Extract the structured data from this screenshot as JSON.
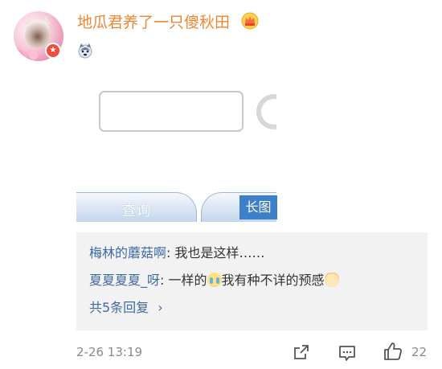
{
  "post": {
    "username": "地瓜君养了一只傻秋田",
    "timestamp": "2-26 13:19",
    "like_count": "22",
    "avatar_badge_icon": "red-star-badge-icon",
    "username_badge_icon": "crown-icon",
    "fan_badge_icon": "husky-icon"
  },
  "embedded_image": {
    "query_button_label": "查询",
    "long_image_label": "长图"
  },
  "comments": [
    {
      "author": "梅林的蘑菇啊",
      "text": ": 我也是这样……"
    },
    {
      "author": "夏夏夏夏_呀",
      "text_before": ": 一样的",
      "text_after": "我有种不详的预感"
    }
  ],
  "more_replies_label": "共5条回复",
  "colors": {
    "username": "#f08634",
    "link": "#3f6aa5",
    "comment_bg": "#f2f2f2",
    "long_image_badge": "#3d7fc9"
  }
}
